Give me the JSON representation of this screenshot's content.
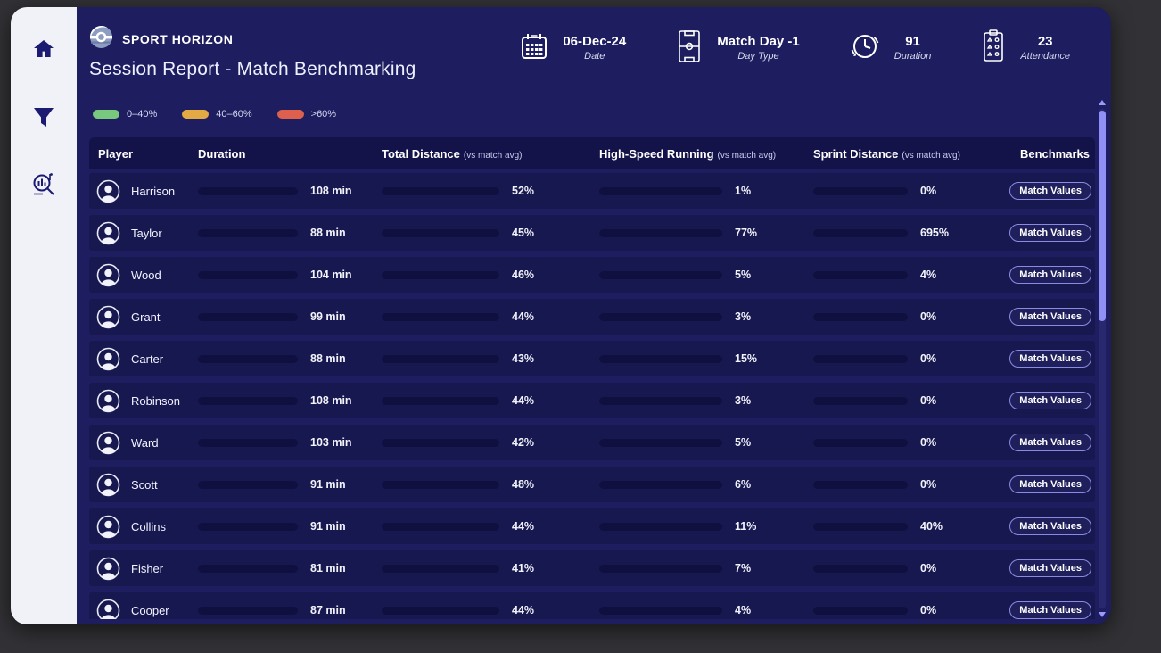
{
  "brand": {
    "name": "SPORT HORIZON"
  },
  "page_title": "Session Report - Match Benchmarking",
  "sidebar": {
    "items": [
      {
        "icon": "home-icon"
      },
      {
        "icon": "filter-icon"
      },
      {
        "icon": "search-analytics-icon"
      }
    ]
  },
  "header_stats": [
    {
      "icon": "calendar-icon",
      "value": "06-Dec-24",
      "label": "Date"
    },
    {
      "icon": "pitch-icon",
      "value": "Match Day -1",
      "label": "Day Type"
    },
    {
      "icon": "clock-icon",
      "value": "91",
      "label": "Duration"
    },
    {
      "icon": "attendance-icon",
      "value": "23",
      "label": "Attendance"
    }
  ],
  "legend": [
    {
      "label": "0–40%",
      "color": "#78c87d"
    },
    {
      "label": "40–60%",
      "color": "#e2a945"
    },
    {
      "label": ">60%",
      "color": "#dc604d"
    }
  ],
  "colors": {
    "background": "#1d1d5f",
    "row": "#181850",
    "table_header": "#13134a",
    "duration_bar_from": "#4f4fca",
    "duration_bar_to": "#a6a6ff",
    "green": "#78c47c",
    "amber": "#e2a945",
    "red": "#dc604d",
    "scrollbar_thumb": "#8f8ff5",
    "sidebar": "#f1f2f7"
  },
  "table": {
    "duration_axis_max": 120,
    "benchmark_label": "Match Values",
    "columns": [
      {
        "label": "Player",
        "sub": ""
      },
      {
        "label": "Duration",
        "sub": ""
      },
      {
        "label": "Total Distance",
        "sub": "(vs match avg)"
      },
      {
        "label": "High-Speed Running",
        "sub": "(vs match avg)"
      },
      {
        "label": "Sprint Distance",
        "sub": "(vs match avg)"
      },
      {
        "label": "Benchmarks",
        "sub": ""
      }
    ],
    "rows": [
      {
        "player": "Harrison",
        "duration_min": 108,
        "duration_label": "108 min",
        "total_distance_pct": 52,
        "total_distance_label": "52%",
        "hsr_pct": 1,
        "hsr_label": "1%",
        "sprint_pct": 0,
        "sprint_label": "0%"
      },
      {
        "player": "Taylor",
        "duration_min": 88,
        "duration_label": "88 min",
        "total_distance_pct": 45,
        "total_distance_label": "45%",
        "hsr_pct": 77,
        "hsr_label": "77%",
        "sprint_pct": 695,
        "sprint_label": "695%"
      },
      {
        "player": "Wood",
        "duration_min": 104,
        "duration_label": "104 min",
        "total_distance_pct": 46,
        "total_distance_label": "46%",
        "hsr_pct": 5,
        "hsr_label": "5%",
        "sprint_pct": 4,
        "sprint_label": "4%"
      },
      {
        "player": "Grant",
        "duration_min": 99,
        "duration_label": "99 min",
        "total_distance_pct": 44,
        "total_distance_label": "44%",
        "hsr_pct": 3,
        "hsr_label": "3%",
        "sprint_pct": 0,
        "sprint_label": "0%"
      },
      {
        "player": "Carter",
        "duration_min": 88,
        "duration_label": "88 min",
        "total_distance_pct": 43,
        "total_distance_label": "43%",
        "hsr_pct": 15,
        "hsr_label": "15%",
        "sprint_pct": 0,
        "sprint_label": "0%"
      },
      {
        "player": "Robinson",
        "duration_min": 108,
        "duration_label": "108 min",
        "total_distance_pct": 44,
        "total_distance_label": "44%",
        "hsr_pct": 3,
        "hsr_label": "3%",
        "sprint_pct": 0,
        "sprint_label": "0%"
      },
      {
        "player": "Ward",
        "duration_min": 103,
        "duration_label": "103 min",
        "total_distance_pct": 42,
        "total_distance_label": "42%",
        "hsr_pct": 5,
        "hsr_label": "5%",
        "sprint_pct": 0,
        "sprint_label": "0%"
      },
      {
        "player": "Scott",
        "duration_min": 91,
        "duration_label": "91 min",
        "total_distance_pct": 48,
        "total_distance_label": "48%",
        "hsr_pct": 6,
        "hsr_label": "6%",
        "sprint_pct": 0,
        "sprint_label": "0%"
      },
      {
        "player": "Collins",
        "duration_min": 91,
        "duration_label": "91 min",
        "total_distance_pct": 44,
        "total_distance_label": "44%",
        "hsr_pct": 11,
        "hsr_label": "11%",
        "sprint_pct": 40,
        "sprint_label": "40%"
      },
      {
        "player": "Fisher",
        "duration_min": 81,
        "duration_label": "81 min",
        "total_distance_pct": 41,
        "total_distance_label": "41%",
        "hsr_pct": 7,
        "hsr_label": "7%",
        "sprint_pct": 0,
        "sprint_label": "0%"
      },
      {
        "player": "Cooper",
        "duration_min": 87,
        "duration_label": "87 min",
        "total_distance_pct": 44,
        "total_distance_label": "44%",
        "hsr_pct": 4,
        "hsr_label": "4%",
        "sprint_pct": 0,
        "sprint_label": "0%"
      }
    ]
  }
}
